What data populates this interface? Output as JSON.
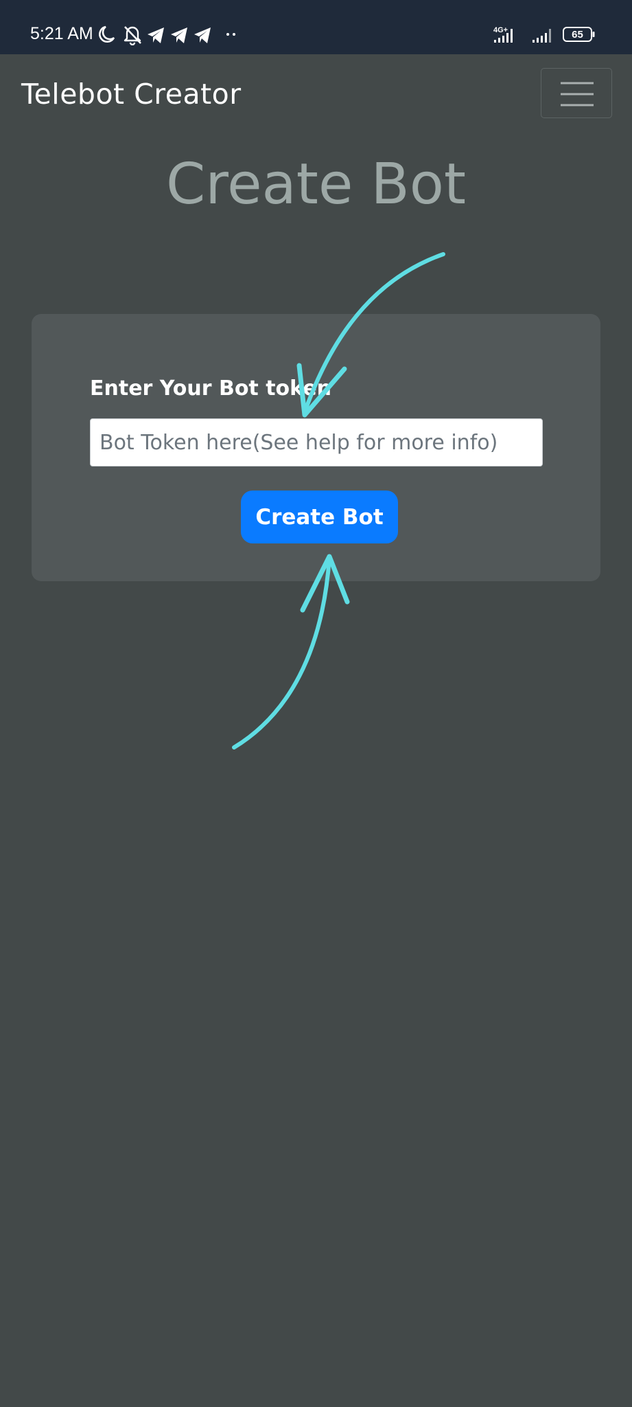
{
  "status_bar": {
    "time": "5:21 AM",
    "icons": [
      "moon-icon",
      "bell-off-icon",
      "telegram-icon",
      "telegram-icon",
      "telegram-icon",
      "more-dots-icon"
    ],
    "network_label": "4G+",
    "battery_level": "65"
  },
  "navbar": {
    "brand": "Telebot Creator",
    "menu_icon": "hamburger-menu-icon"
  },
  "main": {
    "title": "Create Bot",
    "token_label": "Enter Your Bot token",
    "token_placeholder": "Bot Token here(See help for more info)",
    "token_value": "",
    "submit_label": "Create Bot"
  },
  "annotations": {
    "arrow_color": "#5fdde3",
    "icons": [
      "arrow-to-token-field",
      "arrow-to-create-button"
    ]
  },
  "colors": {
    "status_bar_bg": "#1f2a3a",
    "page_bg": "#434949",
    "card_bg": "#525859",
    "title_color": "#9da8a6",
    "button_bg": "#0a7bff"
  }
}
